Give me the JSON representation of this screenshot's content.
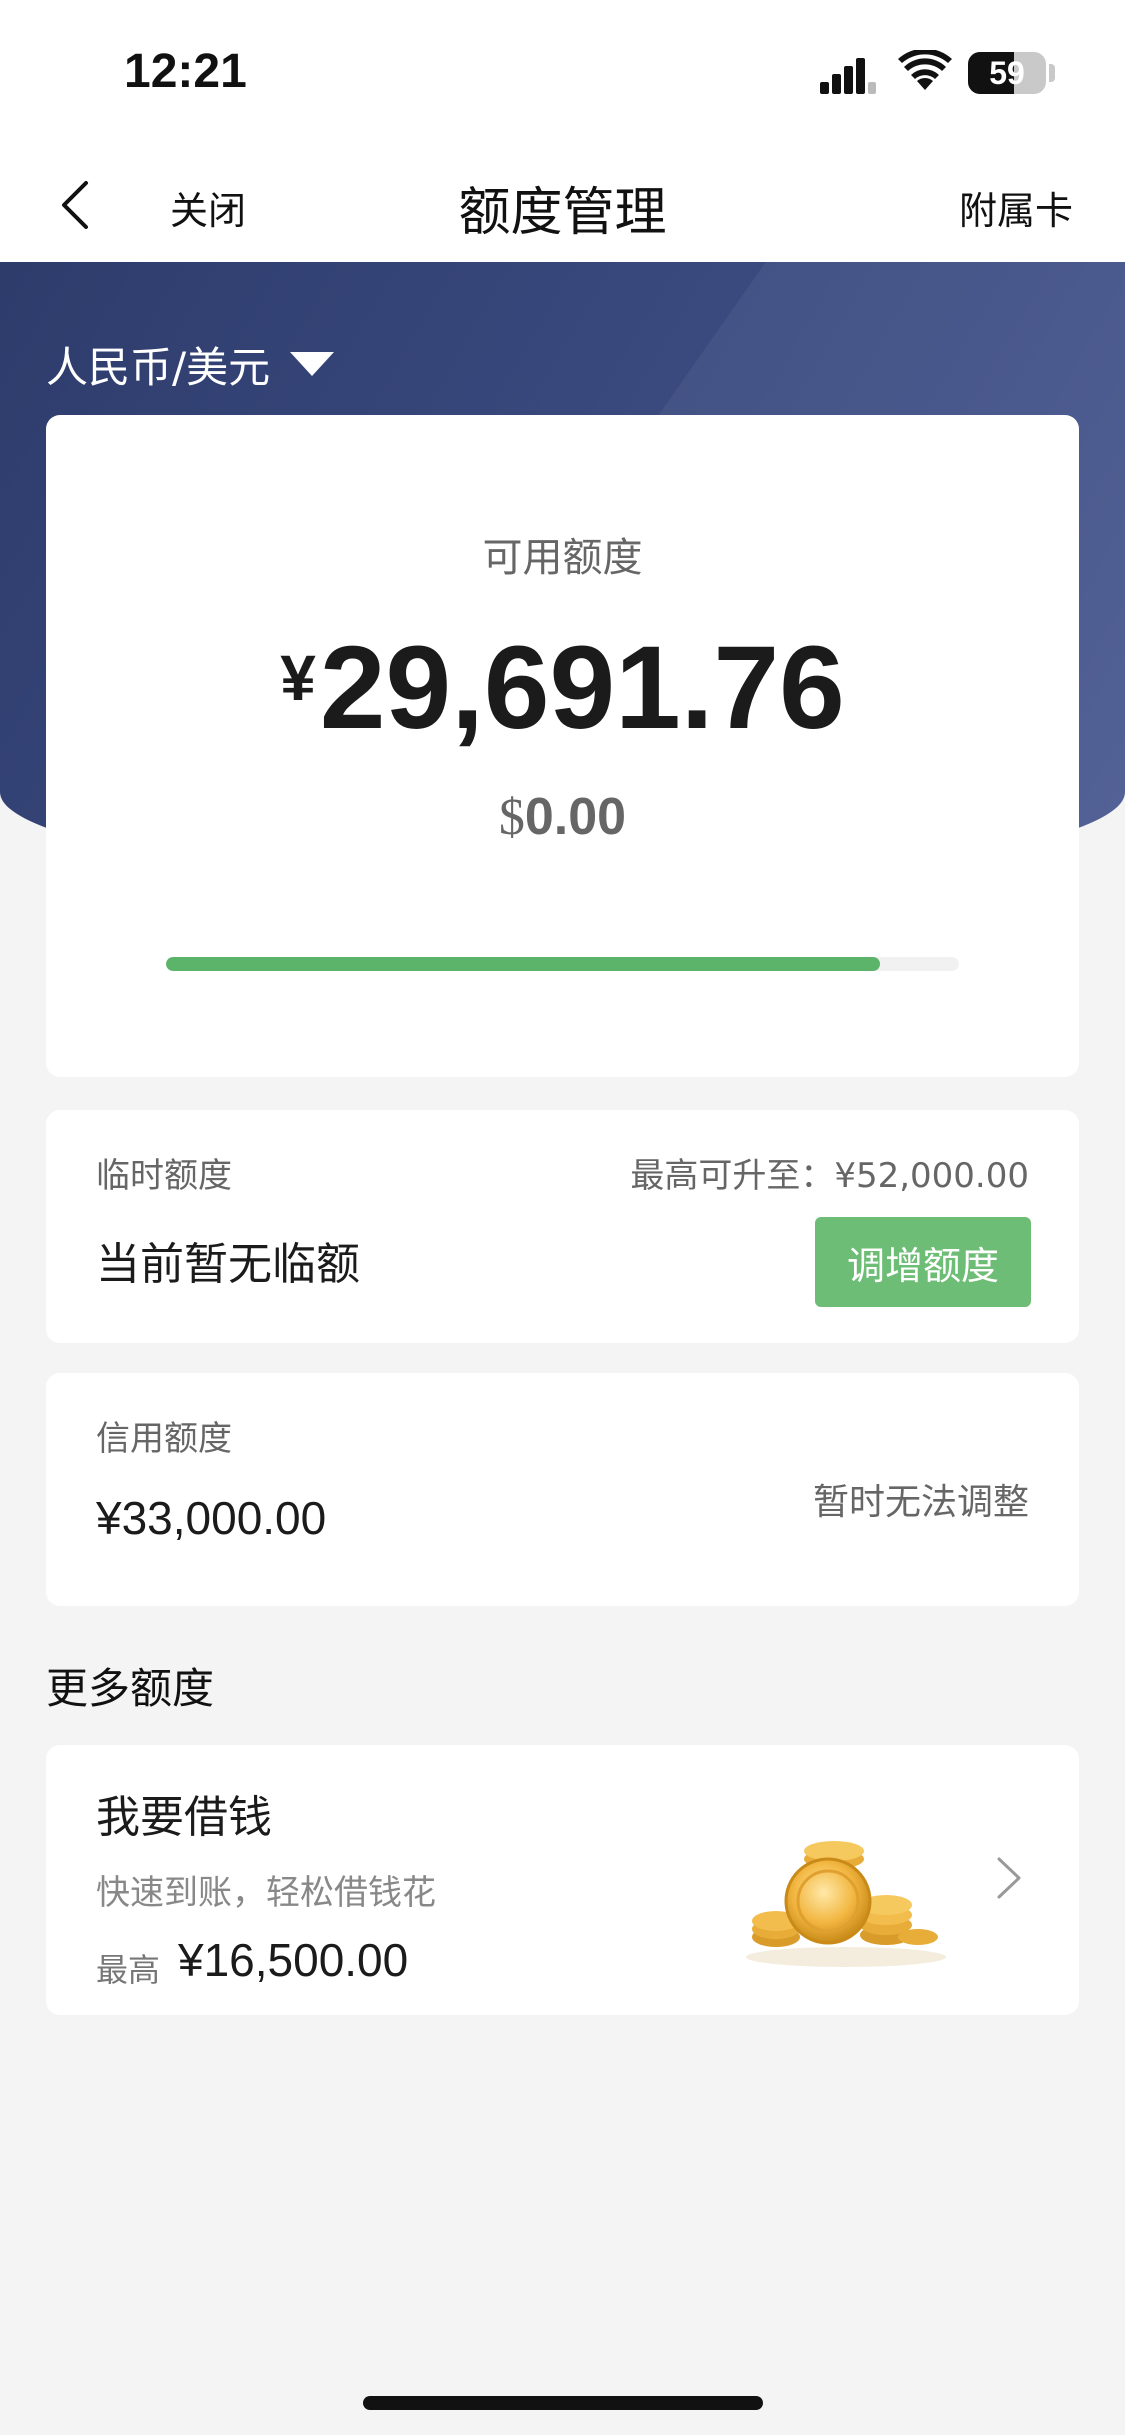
{
  "status_bar": {
    "time": "12:21",
    "battery_level": "59",
    "battery_fraction": 0.59
  },
  "nav": {
    "close_label": "关闭",
    "title": "额度管理",
    "right_label": "附属卡"
  },
  "currency": {
    "selector_label": "人民币/美元"
  },
  "available": {
    "label": "可用额度",
    "cny_symbol": "¥",
    "cny_amount": "29,691.76",
    "usd_symbol": "$",
    "usd_amount": "0.00",
    "usage_fraction": 0.9
  },
  "temp_limit": {
    "label": "临时额度",
    "max_text": "最高可升至：¥52,000.00",
    "value": "当前暂无临额",
    "button_label": "调增额度"
  },
  "credit_limit": {
    "label": "信用额度",
    "value": "¥33,000.00",
    "status": "暂时无法调整"
  },
  "more": {
    "section_title": "更多额度",
    "loan": {
      "title": "我要借钱",
      "subtitle": "快速到账，轻松借钱花",
      "max_label": "最高",
      "max_value": "¥16,500.00"
    }
  },
  "colors": {
    "hero_bg": "#3b4b80",
    "accent_green": "#6ebd76",
    "progress_green": "#5cb46a"
  },
  "icons": {
    "back": "chevron-left-icon",
    "dropdown": "caret-down-icon",
    "loan_arrow": "chevron-right-icon",
    "loan_image": "gold-coins-icon"
  }
}
